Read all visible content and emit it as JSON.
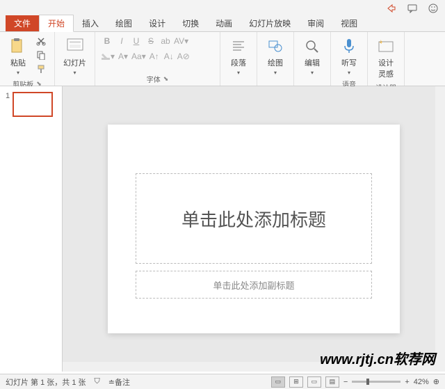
{
  "tabs": {
    "file": "文件",
    "home": "开始",
    "insert": "插入",
    "draw": "绘图",
    "design": "设计",
    "transition": "切换",
    "animation": "动画",
    "slideshow": "幻灯片放映",
    "review": "审阅",
    "view": "视图"
  },
  "ribbon": {
    "clipboard": {
      "paste": "粘贴",
      "label": "剪贴板"
    },
    "slides": {
      "slide": "幻灯片",
      "label": ""
    },
    "font": {
      "label": "字体"
    },
    "paragraph": {
      "label": "段落"
    },
    "drawing": {
      "label": "绘图"
    },
    "editing": {
      "label": "编辑"
    },
    "voice": {
      "dictate": "听写",
      "label": "语音"
    },
    "designer": {
      "ideas": "设计\n灵感",
      "label": "设计器"
    }
  },
  "slide": {
    "number": "1",
    "title_placeholder": "单击此处添加标题",
    "subtitle_placeholder": "单击此处添加副标题"
  },
  "status": {
    "slide_info": "幻灯片 第 1 张，共 1 张",
    "notes": "备注",
    "zoom_minus": "−",
    "zoom_value": "42%",
    "zoom_plus": "+"
  },
  "watermark": "www.rjtj.cn软荐网"
}
